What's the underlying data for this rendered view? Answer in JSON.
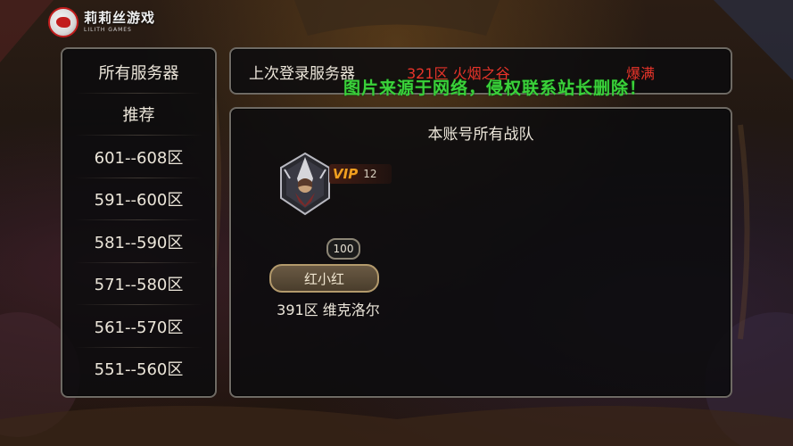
{
  "logo": {
    "name": "莉莉丝游戏",
    "subtitle": "LILITH GAMES"
  },
  "server_list": {
    "items": [
      {
        "label": "所有服务器"
      },
      {
        "label": "推荐"
      },
      {
        "label": "601--608区"
      },
      {
        "label": "591--600区"
      },
      {
        "label": "581--590区"
      },
      {
        "label": "571--580区"
      },
      {
        "label": "561--570区"
      },
      {
        "label": "551--560区"
      }
    ]
  },
  "last_login": {
    "label": "上次登录服务器",
    "server": "321区  火烟之谷",
    "status": "爆满",
    "status_color": "#e8342a"
  },
  "watermark": "图片来源于网络，侵权联系站长删除！",
  "teams": {
    "title": "本账号所有战队",
    "items": [
      {
        "vip_label": "VIP",
        "vip_level": "12",
        "level": "100",
        "name": "红小红",
        "server": "391区  维克洛尔",
        "avatar_icon": "assassin-hero-avatar"
      }
    ]
  }
}
